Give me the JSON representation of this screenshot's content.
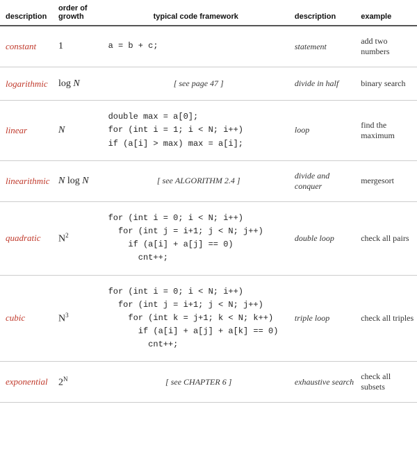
{
  "headers": {
    "col1": "description",
    "col2": "order of growth",
    "col3": "typical code framework",
    "col4": "description",
    "col5": "example"
  },
  "rows": [
    {
      "name": "constant",
      "order": "1",
      "code_lines": [
        "a = b + c;"
      ],
      "code_type": "plain",
      "desc2": "statement",
      "example": "add two numbers"
    },
    {
      "name": "logarithmic",
      "order": "log N",
      "code_lines": [
        "[ see page 47 ]"
      ],
      "code_type": "ref",
      "desc2": "divide in half",
      "example": "binary search"
    },
    {
      "name": "linear",
      "order": "N",
      "code_lines": [
        "double max = a[0];",
        "for (int i = 1; i < N; i++)",
        "    if (a[i] > max) max = a[i];"
      ],
      "code_type": "plain",
      "desc2": "loop",
      "example": "find the maximum"
    },
    {
      "name": "linearithmic",
      "order": "N log N",
      "code_lines": [
        "[ see ALGORITHM 2.4 ]"
      ],
      "code_type": "ref_smallcaps",
      "desc2": "divide and conquer",
      "example": "mergesort"
    },
    {
      "name": "quadratic",
      "order": "N²",
      "code_lines": [
        "for (int i = 0; i < N; i++)",
        "  for (int j = i+1; j < N; j++)",
        "    if (a[i] + a[j] == 0)",
        "      cnt++;"
      ],
      "code_type": "indented",
      "desc2": "double loop",
      "example": "check all pairs"
    },
    {
      "name": "cubic",
      "order": "N³",
      "code_lines": [
        "for (int i = 0; i < N; i++)",
        "  for (int j = i+1; j < N; j++)",
        "    for (int k = j+1; k < N; k++)",
        "      if (a[i] + a[j] + a[k] == 0)",
        "        cnt++;"
      ],
      "code_type": "indented",
      "desc2": "triple loop",
      "example": "check all triples"
    },
    {
      "name": "exponential",
      "order": "2^N",
      "code_lines": [
        "[ see CHAPTER 6 ]"
      ],
      "code_type": "ref_smallcaps",
      "desc2": "exhaustive search",
      "example": "check all subsets"
    }
  ]
}
